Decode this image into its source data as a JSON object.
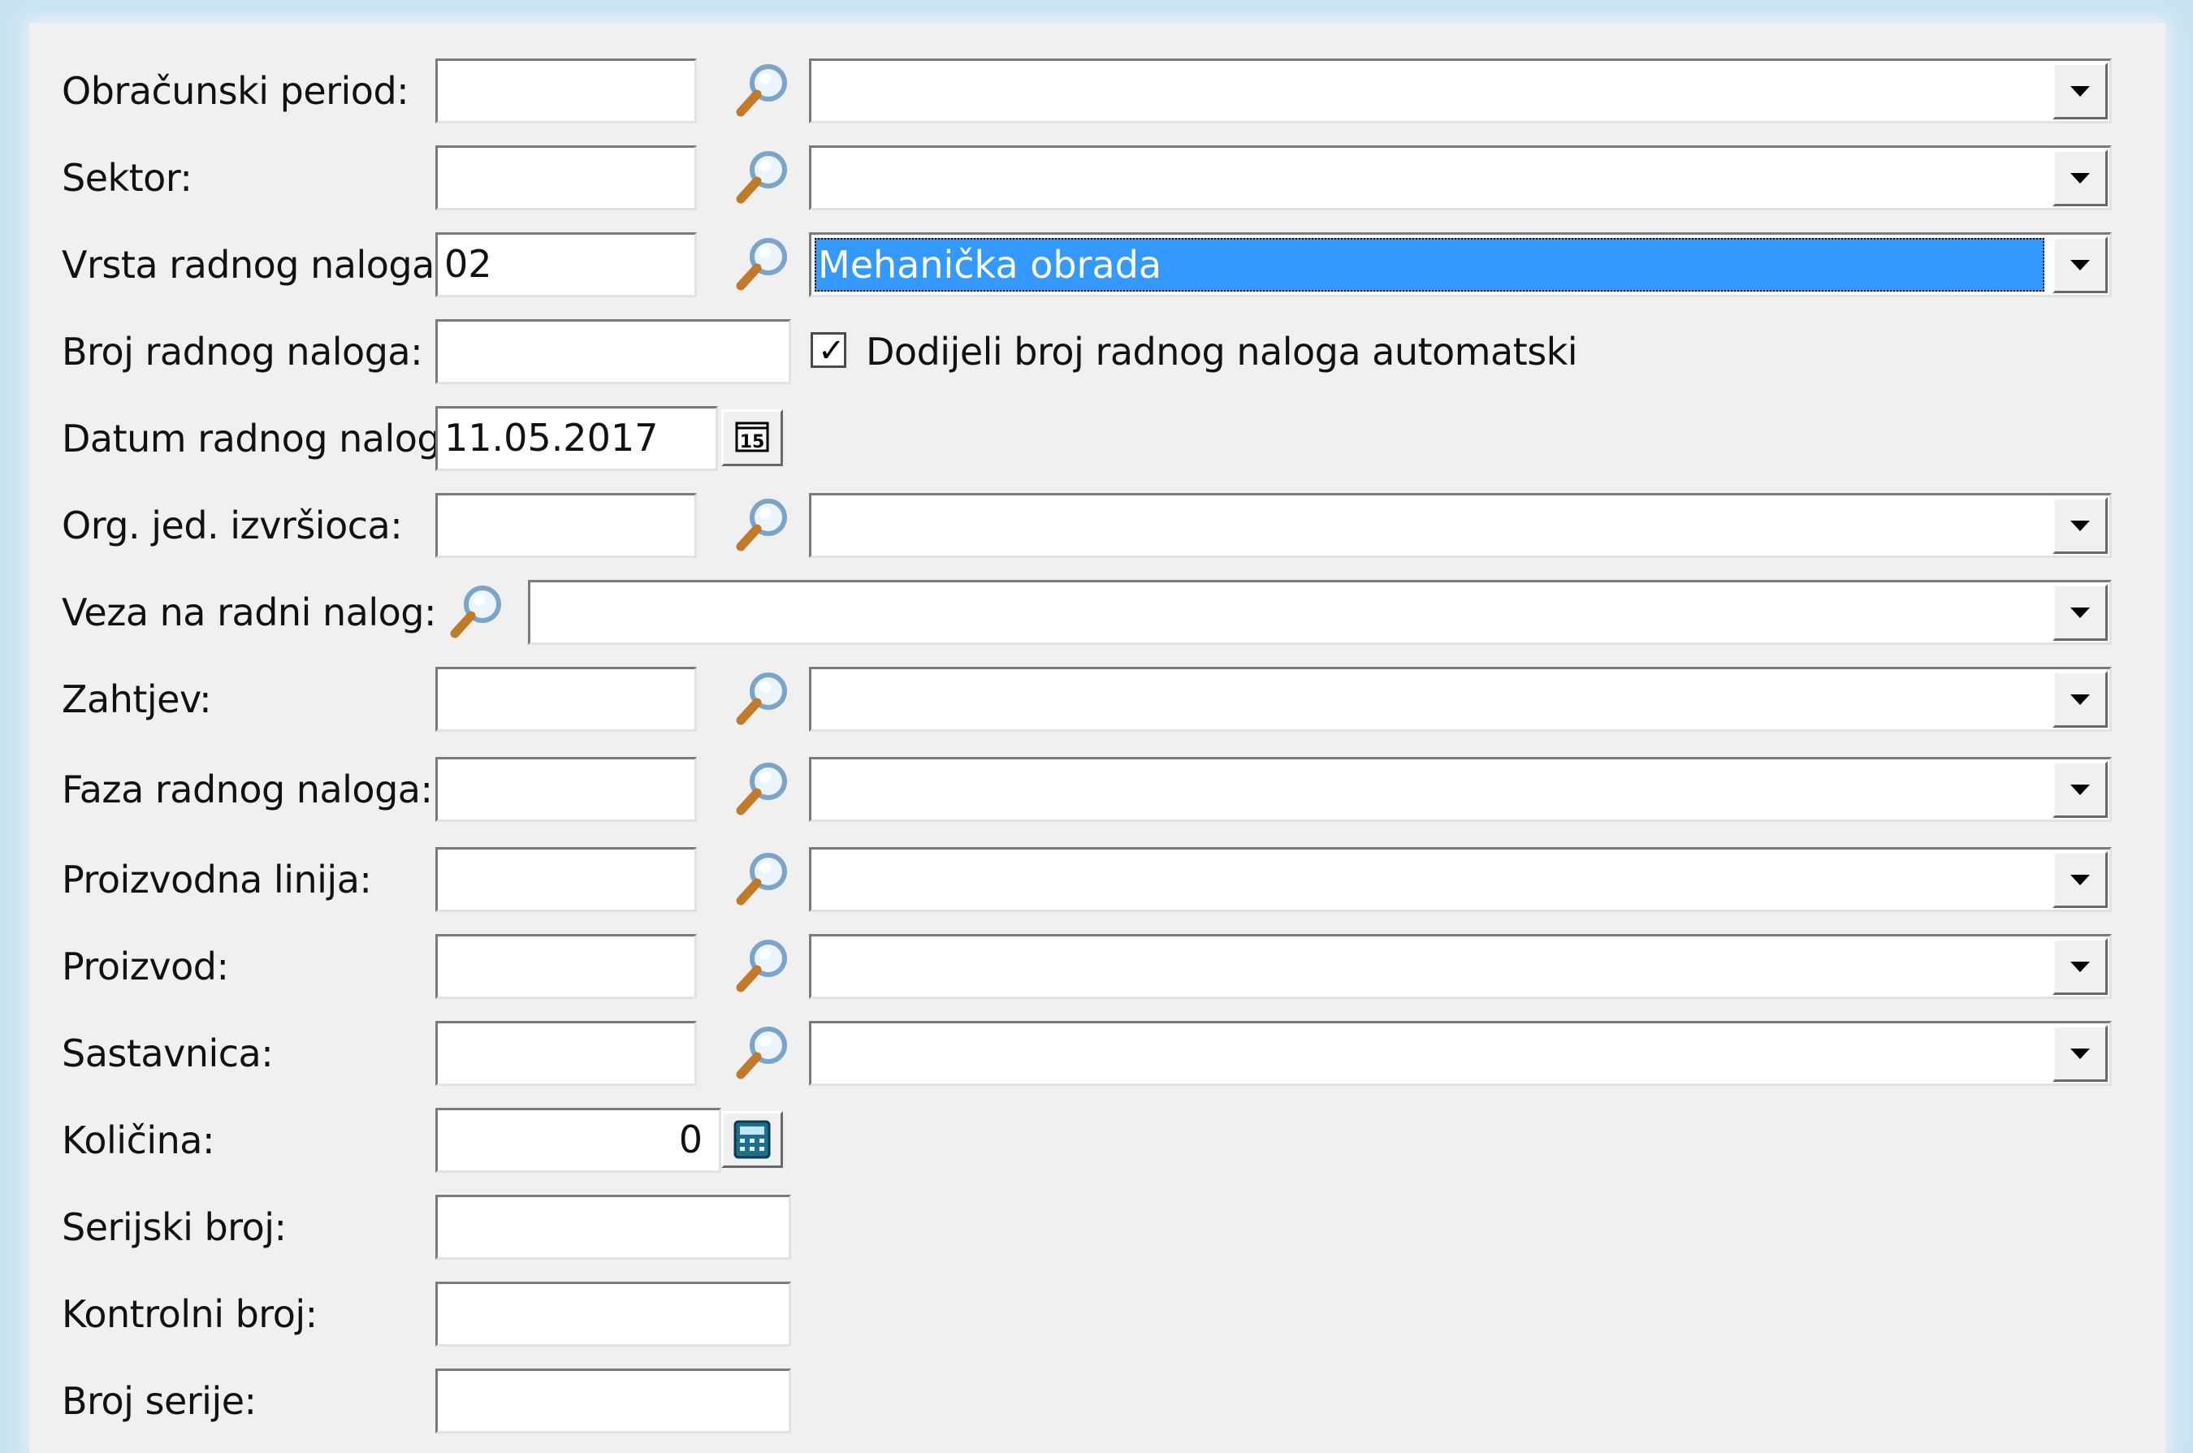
{
  "form": {
    "period": {
      "label": "Obračunski period:",
      "code": "",
      "name": ""
    },
    "sector": {
      "label": "Sektor:",
      "code": "",
      "name": ""
    },
    "order_type": {
      "label": "Vrsta radnog naloga:",
      "code": "02",
      "name": "Mehanička obrada"
    },
    "order_number": {
      "label": "Broj radnog naloga:",
      "value": "",
      "auto_assign_label": "Dodijeli broj radnog naloga automatski",
      "auto_assign_checked": true
    },
    "order_date": {
      "label": "Datum radnog naloga:",
      "value": "11.05.2017",
      "calendar_glyph": "15"
    },
    "org_unit": {
      "label": "Org. jed. izvršioca:",
      "code": "",
      "name": ""
    },
    "link_order": {
      "label": "Veza na radni nalog:",
      "name": ""
    },
    "request": {
      "label": "Zahtjev:",
      "code": "",
      "name": ""
    },
    "phase": {
      "label": "Faza radnog naloga:",
      "code": "",
      "name": ""
    },
    "production_line": {
      "label": "Proizvodna linija:",
      "code": "",
      "name": ""
    },
    "product": {
      "label": "Proizvod:",
      "code": "",
      "name": ""
    },
    "bom": {
      "label": "Sastavnica:",
      "code": "",
      "name": ""
    },
    "quantity": {
      "label": "Količina:",
      "value": "0"
    },
    "serial_number": {
      "label": "Serijski broj:",
      "value": ""
    },
    "control_number": {
      "label": "Kontrolni broj:",
      "value": ""
    },
    "batch_number": {
      "label": "Broj serije:",
      "value": ""
    }
  },
  "colors": {
    "selection": "#3399ff",
    "panel": "#f0f0f0",
    "backdrop": "#c8e3f2"
  }
}
